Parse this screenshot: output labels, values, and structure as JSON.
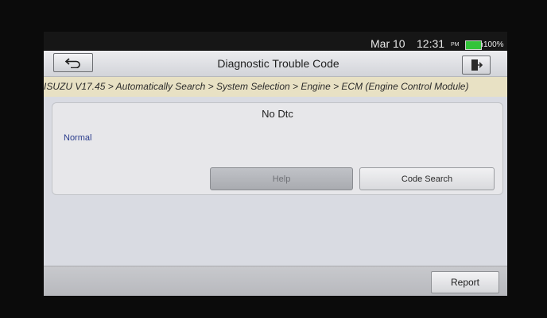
{
  "status_bar": {
    "date": "Mar 10",
    "time": "12:31",
    "ampm": "PM",
    "battery_percent": "100%",
    "battery_color": "#33c43a"
  },
  "header": {
    "title": "Diagnostic Trouble Code",
    "back_icon": "back-arrow-icon",
    "exit_icon": "exit-door-icon"
  },
  "breadcrumb": {
    "text": "ISUZU V17.45 > Automatically Search > System Selection > Engine > ECM (Engine Control Module)"
  },
  "result": {
    "message": "No Dtc",
    "status": "Normal",
    "status_color": "#2a3c8c"
  },
  "actions": {
    "help_label": "Help",
    "code_search_label": "Code Search"
  },
  "footer": {
    "report_label": "Report"
  }
}
